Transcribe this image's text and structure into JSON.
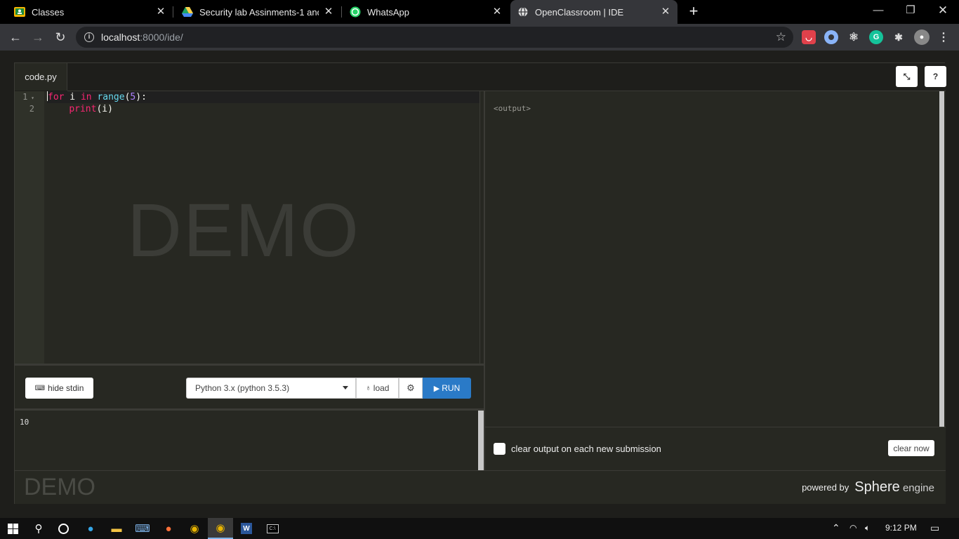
{
  "browser": {
    "tabs": [
      {
        "title": "Classes",
        "icon": "google-classroom-icon",
        "color": "#f5b400"
      },
      {
        "title": "Security lab Assinments-1 and 2",
        "icon": "google-drive-icon",
        "color": "#1fa463"
      },
      {
        "title": "WhatsApp",
        "icon": "whatsapp-icon",
        "color": "#25d366"
      },
      {
        "title": "OpenClassroom | IDE",
        "icon": "globe-icon",
        "color": "#dddddd"
      }
    ],
    "url_host": "localhost",
    "url_path": ":8000/ide/"
  },
  "ide": {
    "file_tab": "code.py",
    "collapse_btn": "⤡",
    "help_btn": "?",
    "gutter": [
      "1",
      "2"
    ],
    "code": {
      "l1_kw_for": "for",
      "l1_var": " i ",
      "l1_kw_in": "in",
      "l1_range": " range",
      "l1_open": "(",
      "l1_num": "5",
      "l1_close": "):",
      "l2_indent": "    ",
      "l2_print": "print",
      "l2_args": "(i)"
    },
    "watermark": "DEMO",
    "hide_stdin": "hide stdin",
    "language": "Python 3.x (python 3.5.3)",
    "load": "load",
    "run": "RUN",
    "stdin_value": "10",
    "output_placeholder": "<output>",
    "clear_option": "clear output on each new submission",
    "clear_now": "clear now",
    "footer_watermark": "DEMO",
    "powered_by": "powered by",
    "engine_name": "Sphere",
    "engine_suffix": " engine"
  },
  "taskbar": {
    "time": "9:12 PM"
  }
}
